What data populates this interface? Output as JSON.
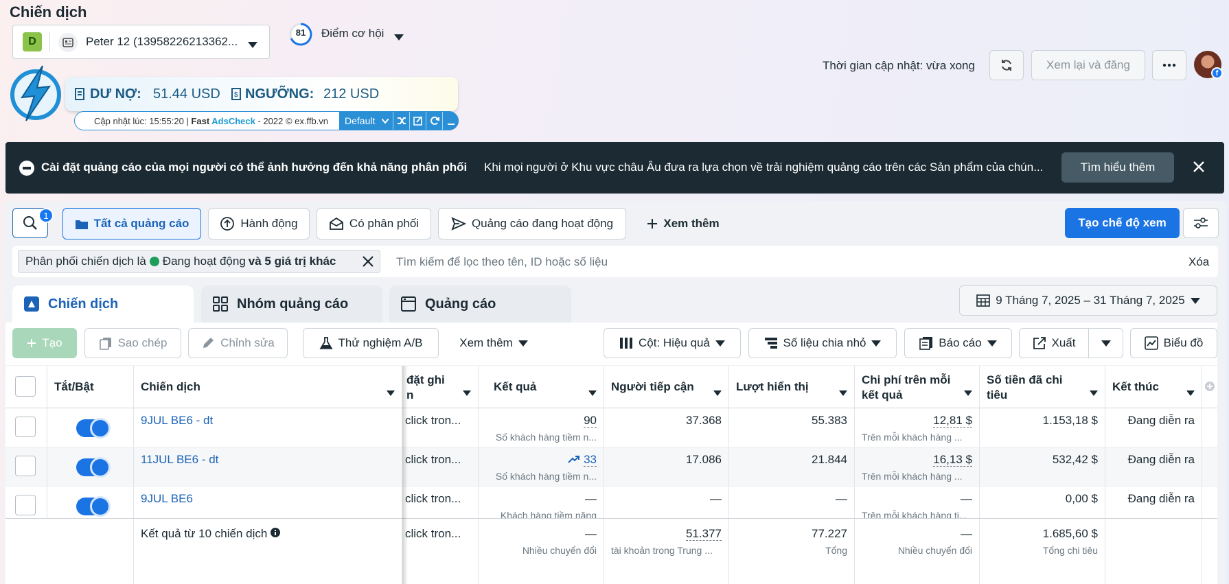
{
  "page_title": "Chiến dịch",
  "account": {
    "badge": "D",
    "name": "Peter 12 (13958226213362..."
  },
  "opportunity": {
    "score": "81",
    "label": "Điểm cơ hội"
  },
  "adscheck": {
    "debt_label": "DƯ NỢ:",
    "debt_value": "51.44 USD",
    "threshold_label": "NGƯỠNG:",
    "threshold_value": "212 USD",
    "updated_prefix": "Cập nhật lúc: 15:55:20 | ",
    "brand_fast": "Fast ",
    "brand_adscheck": "AdsCheck",
    "brand_suffix": " - 2022 © ex.ffb.vn",
    "select_value": "Default"
  },
  "header": {
    "update_time": "Thời gian cập nhật: vừa xong",
    "review_label": "Xem lại và đăng"
  },
  "notice": {
    "title": "Cài đặt quảng cáo của mọi người có thể ảnh hưởng đến khả năng phân phối",
    "body": "Khi mọi người ở Khu vực châu Âu đưa ra lựa chọn về trải nghiệm quảng cáo trên các Sản phẩm của chún...",
    "button": "Tìm hiểu thêm"
  },
  "filters": {
    "search_badge": "1",
    "all_ads": "Tất cả quảng cáo",
    "action": "Hành động",
    "delivery": "Có phân phối",
    "active_ads": "Quảng cáo đang hoạt động",
    "see_more": "Xem thêm",
    "create_view": "Tạo chế độ xem",
    "chip_prefix": "Phân phối chiến dịch là",
    "chip_status": "Đang hoạt động",
    "chip_more": "và 5 giá trị khác",
    "search_placeholder": "Tìm kiếm để lọc theo tên, ID hoặc số liệu",
    "clear": "Xóa"
  },
  "tabs": {
    "campaign": "Chiến dịch",
    "adset": "Nhóm quảng cáo",
    "ad": "Quảng cáo"
  },
  "date_range": "9 Tháng 7, 2025 – 31 Tháng 7, 2025",
  "toolbar": {
    "create": "Tạo",
    "copy": "Sao chép",
    "edit": "Chỉnh sửa",
    "ab_test": "Thử nghiệm A/B",
    "more": "Xem thêm",
    "columns": "Cột: Hiệu quả",
    "breakdown": "Số liệu chia nhỏ",
    "report": "Báo cáo",
    "export": "Xuất",
    "chart": "Biểu đồ"
  },
  "table": {
    "headers": {
      "toggle": "Tắt/Bật",
      "campaign": "Chiến dịch",
      "attribution_1": "đặt ghi",
      "attribution_2": "n",
      "results": "Kết quả",
      "reach": "Người tiếp cận",
      "impressions": "Lượt hiển thị",
      "cpr_1": "Chi phí trên mỗi",
      "cpr_2": "kết quả",
      "spent_1": "Số tiền đã chi",
      "spent_2": "tiêu",
      "end": "Kết thúc"
    },
    "rows": [
      {
        "name": "9JUL BE6 - dt",
        "attribution": "click tron...",
        "result": "90",
        "result_sub": "Số khách hàng tiềm n...",
        "reach": "37.368",
        "impressions": "55.383",
        "cpr": "12,81 $",
        "cpr_sub": "Trên mỗi khách hàng ...",
        "spent": "1.153,18 $",
        "end": "Đang diễn ra"
      },
      {
        "name": "11JUL BE6 - dt",
        "attribution": "click tron...",
        "result": "33",
        "result_sub": "Số khách hàng tiềm n...",
        "reach": "17.086",
        "impressions": "21.844",
        "cpr": "16,13 $",
        "cpr_sub": "Trên mỗi khách hàng ...",
        "spent": "532,42 $",
        "end": "Đang diễn ra"
      },
      {
        "name": "9JUL BE6",
        "attribution": "click tron...",
        "result": "—",
        "result_sub": "Khách hàng tiềm năng",
        "reach": "—",
        "impressions": "—",
        "cpr": "—",
        "cpr_sub": "Trên mỗi khách hàng ti...",
        "spent": "0,00 $",
        "end": "Đang diễn ra"
      }
    ],
    "summary": {
      "label": "Kết quả từ 10 chiến dịch",
      "attribution": "click tron...",
      "result": "—",
      "result_sub": "Nhiều chuyển đổi",
      "reach": "51.377",
      "reach_sub": "tài khoản trong Trung ...",
      "impressions": "77.227",
      "impressions_sub": "Tổng",
      "cpr": "—",
      "cpr_sub": "Nhiều chuyển đổi",
      "spent": "1.685,60 $",
      "spent_sub": "Tổng chi tiêu"
    }
  },
  "colors": {
    "accent": "#1b74e4",
    "notice_bg": "#1c2b33",
    "create_disabled": "#a8d7b9",
    "adscheck_blue": "#2b8fd6"
  }
}
